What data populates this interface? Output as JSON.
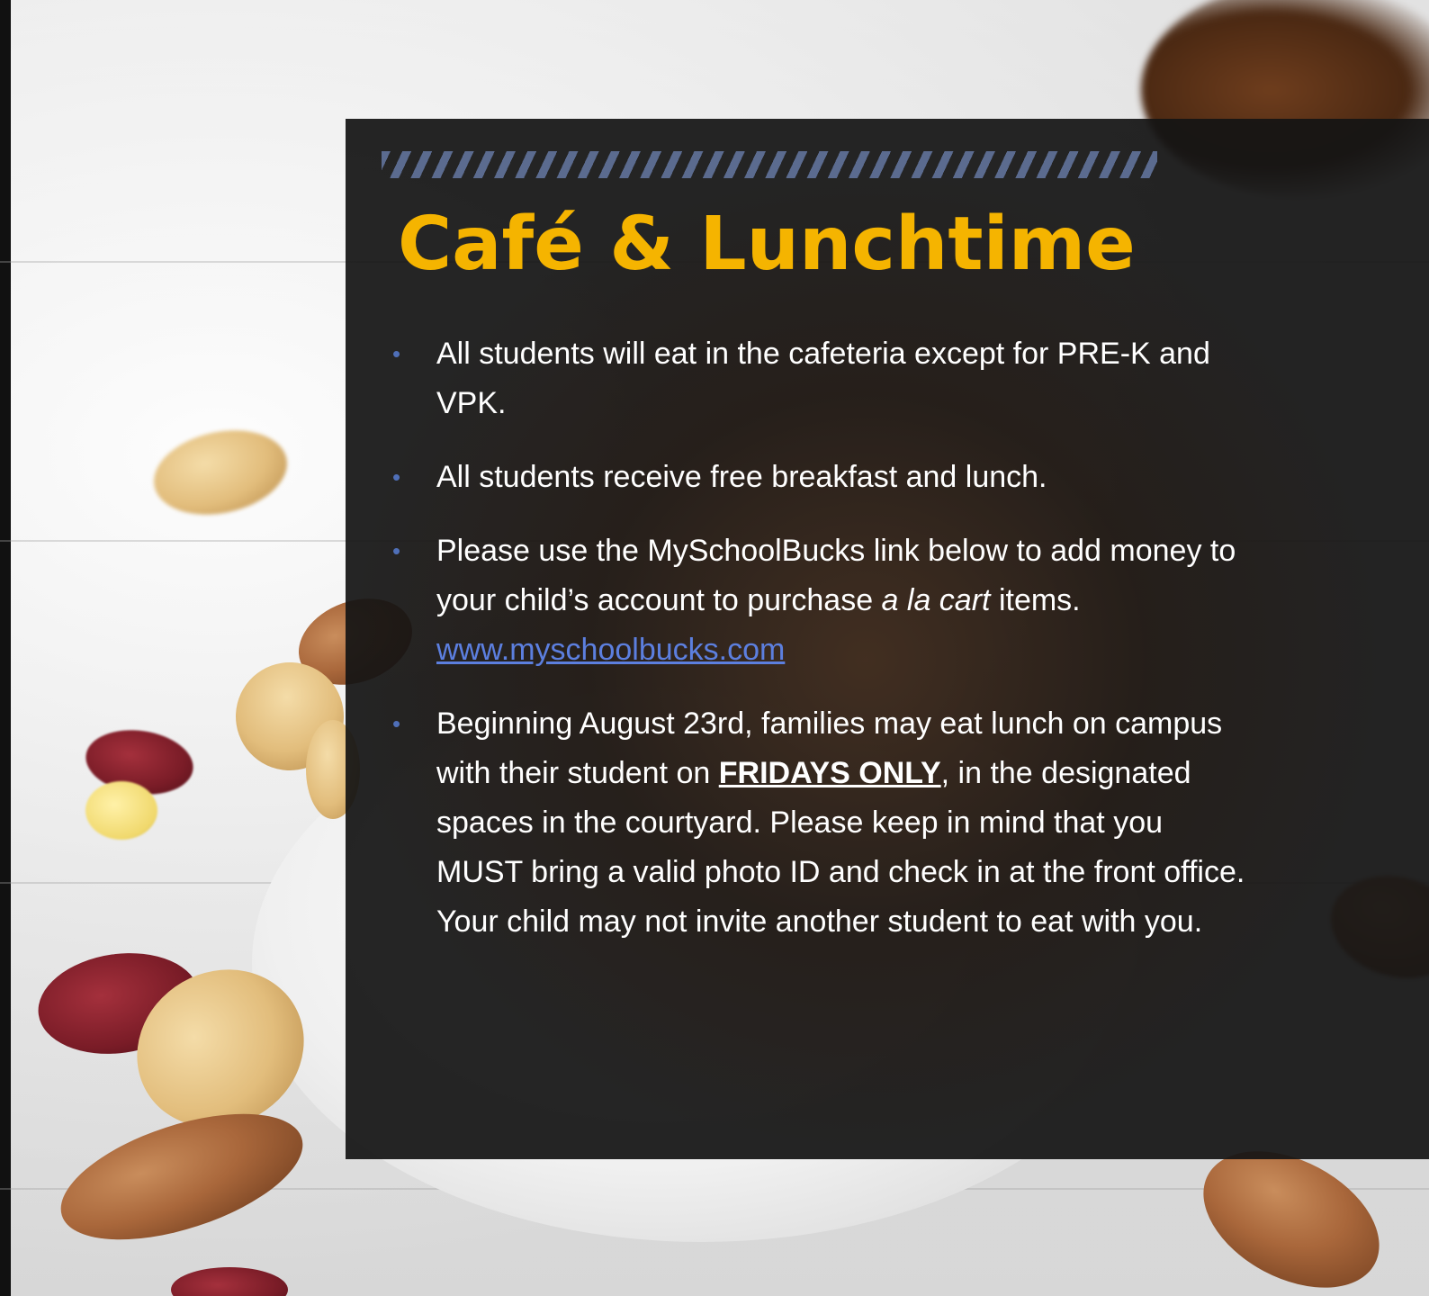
{
  "slide": {
    "title": "Café & Lunchtime",
    "bullets": [
      {
        "text": "All students will eat in the cafeteria except for PRE-K  and VPK."
      },
      {
        "text": "All students receive free breakfast and lunch."
      },
      {
        "before": "Please use the MySchoolBucks link below to add money to your child’s account to purchase ",
        "italic": "a la cart",
        "after": " items.  ",
        "link": "www.myschoolbucks.com "
      },
      {
        "before": "Beginning August 23rd, families may eat lunch on campus with their student on ",
        "bold_underline": "FRIDAYS ONLY",
        "after": ", in the designated spaces in the courtyard.  Please keep in mind that you MUST bring a valid photo ID and check in at the front office. Your child may not invite another student to eat with you."
      }
    ]
  },
  "icons": {
    "bullet": "bullet-dot-icon",
    "title_decoration": "hatched-bar-icon"
  },
  "colors": {
    "title": "#f5b400",
    "bullet": "#4f6fb8",
    "link": "#5c7fdf",
    "panel": "#141414",
    "hatch": "#5b6b8f",
    "body_text": "#ffffff"
  }
}
